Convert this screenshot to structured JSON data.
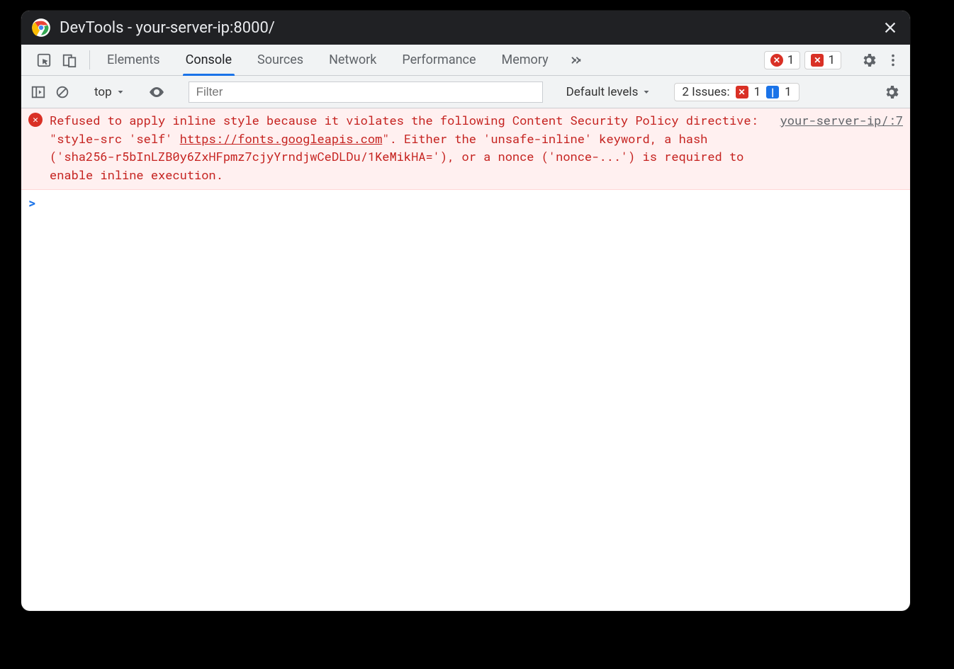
{
  "window": {
    "title": "DevTools - your-server-ip:8000/"
  },
  "tabs": {
    "elements": "Elements",
    "console": "Console",
    "sources": "Sources",
    "network": "Network",
    "performance": "Performance",
    "memory": "Memory"
  },
  "counters": {
    "errors": "1",
    "issues_red": "1"
  },
  "toolbar": {
    "context": "top",
    "filter_placeholder": "Filter",
    "levels": "Default levels",
    "issues_label": "2 Issues:",
    "issues_red": "1",
    "issues_blue": "1"
  },
  "console": {
    "error": {
      "pre": "Refused to apply inline style because it violates the following Content Security Policy directive: \"style-src 'self' ",
      "link": "https://fonts.googleapis.com",
      "post": "\". Either the 'unsafe-inline' keyword, a hash ('sha256-r5bInLZB0y6ZxHFpmz7cjyYrndjwCeDLDu/1KeMikHA='), or a nonce ('nonce-...') is required to enable inline execution.",
      "source": "your-server-ip/:7"
    },
    "prompt": ">"
  }
}
